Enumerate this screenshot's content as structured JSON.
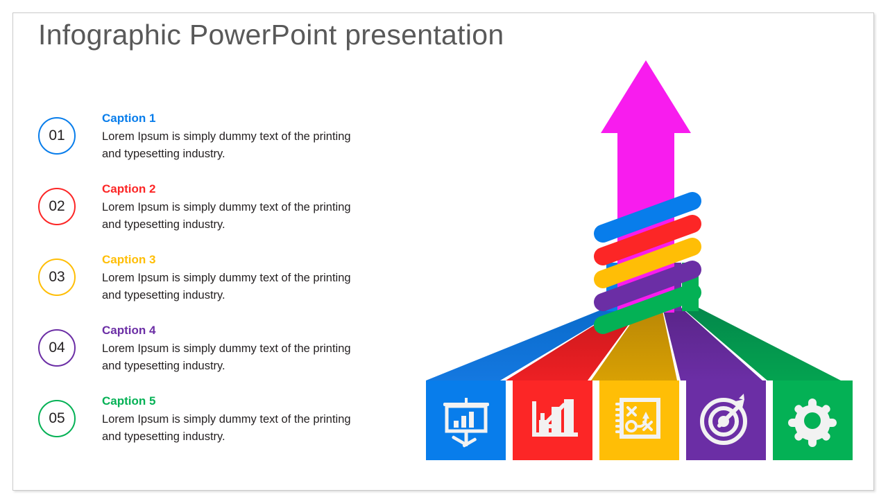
{
  "slide": {
    "title": "Infographic PowerPoint presentation",
    "title_color": "#595959",
    "background": "#ffffff",
    "border_color": "#c9c9c9"
  },
  "items": [
    {
      "number": "01",
      "caption": "Caption 1",
      "description": "Lorem Ipsum is simply dummy text of the printing and typesetting industry.",
      "color": "#087DEB",
      "icon": "presentation-board-icon"
    },
    {
      "number": "02",
      "caption": "Caption 2",
      "description": "Lorem Ipsum is simply dummy text of the printing and typesetting industry.",
      "color": "#FC2626",
      "icon": "bar-chart-growth-icon"
    },
    {
      "number": "03",
      "caption": "Caption 3",
      "description": "Lorem Ipsum is simply dummy text of the printing and typesetting industry.",
      "color": "#FFBE06",
      "icon": "strategy-playbook-icon"
    },
    {
      "number": "04",
      "caption": "Caption 4",
      "description": "Lorem Ipsum is simply dummy text of the printing and typesetting industry.",
      "color": "#6B2EA5",
      "icon": "target-arrow-icon"
    },
    {
      "number": "05",
      "caption": "Caption 5",
      "description": "Lorem Ipsum is simply dummy text of the printing and typesetting industry.",
      "color": "#04B155",
      "icon": "gear-icon"
    }
  ],
  "graphic": {
    "arrow_color": "#F81CEE",
    "arrow_label": "upward-growth-arrow",
    "band_colors": [
      "#087DEB",
      "#FC2626",
      "#FFBE06",
      "#6B2EA5",
      "#04B155"
    ],
    "ribbon_shade_colors": [
      "#0A6BCB",
      "#D41B1B",
      "#D79F04",
      "#5A2589",
      "#039746"
    ]
  }
}
